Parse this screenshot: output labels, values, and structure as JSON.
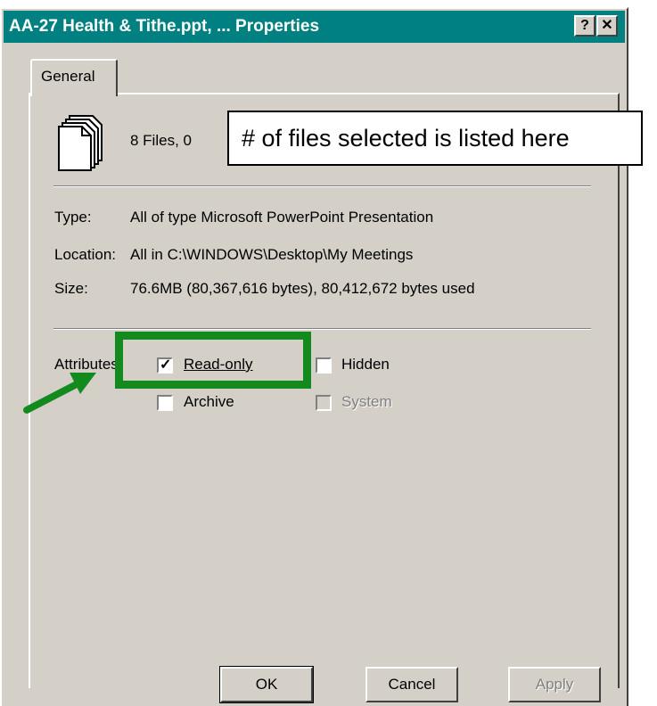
{
  "window": {
    "title": "AA-27 Health & Tithe.ppt, ... Properties",
    "help_label": "?",
    "close_label": "✕"
  },
  "tabs": [
    {
      "label": "General",
      "active": true
    }
  ],
  "summary": {
    "text": "8 Files, 0",
    "icon": "file-stack-icon"
  },
  "info": {
    "type_label": "Type:",
    "type_value": "All of type Microsoft PowerPoint Presentation",
    "location_label": "Location:",
    "location_value": "All in C:\\WINDOWS\\Desktop\\My Meetings",
    "size_label": "Size:",
    "size_value": "76.6MB (80,367,616 bytes), 80,412,672 bytes used"
  },
  "attributes": {
    "label": "Attributes:",
    "read_only": {
      "label": "Read-only",
      "checked": true
    },
    "hidden": {
      "label": "Hidden",
      "checked": false
    },
    "archive": {
      "label": "Archive",
      "checked": false
    },
    "system": {
      "label": "System",
      "checked": false,
      "enabled": false
    }
  },
  "buttons": {
    "ok": "OK",
    "cancel": "Cancel",
    "apply": "Apply"
  },
  "annotation": {
    "callout_text": "# of files selected is listed here",
    "highlight_color": "#138a1e"
  },
  "colors": {
    "titlebar": "#008080",
    "face": "#d4d0c8"
  }
}
